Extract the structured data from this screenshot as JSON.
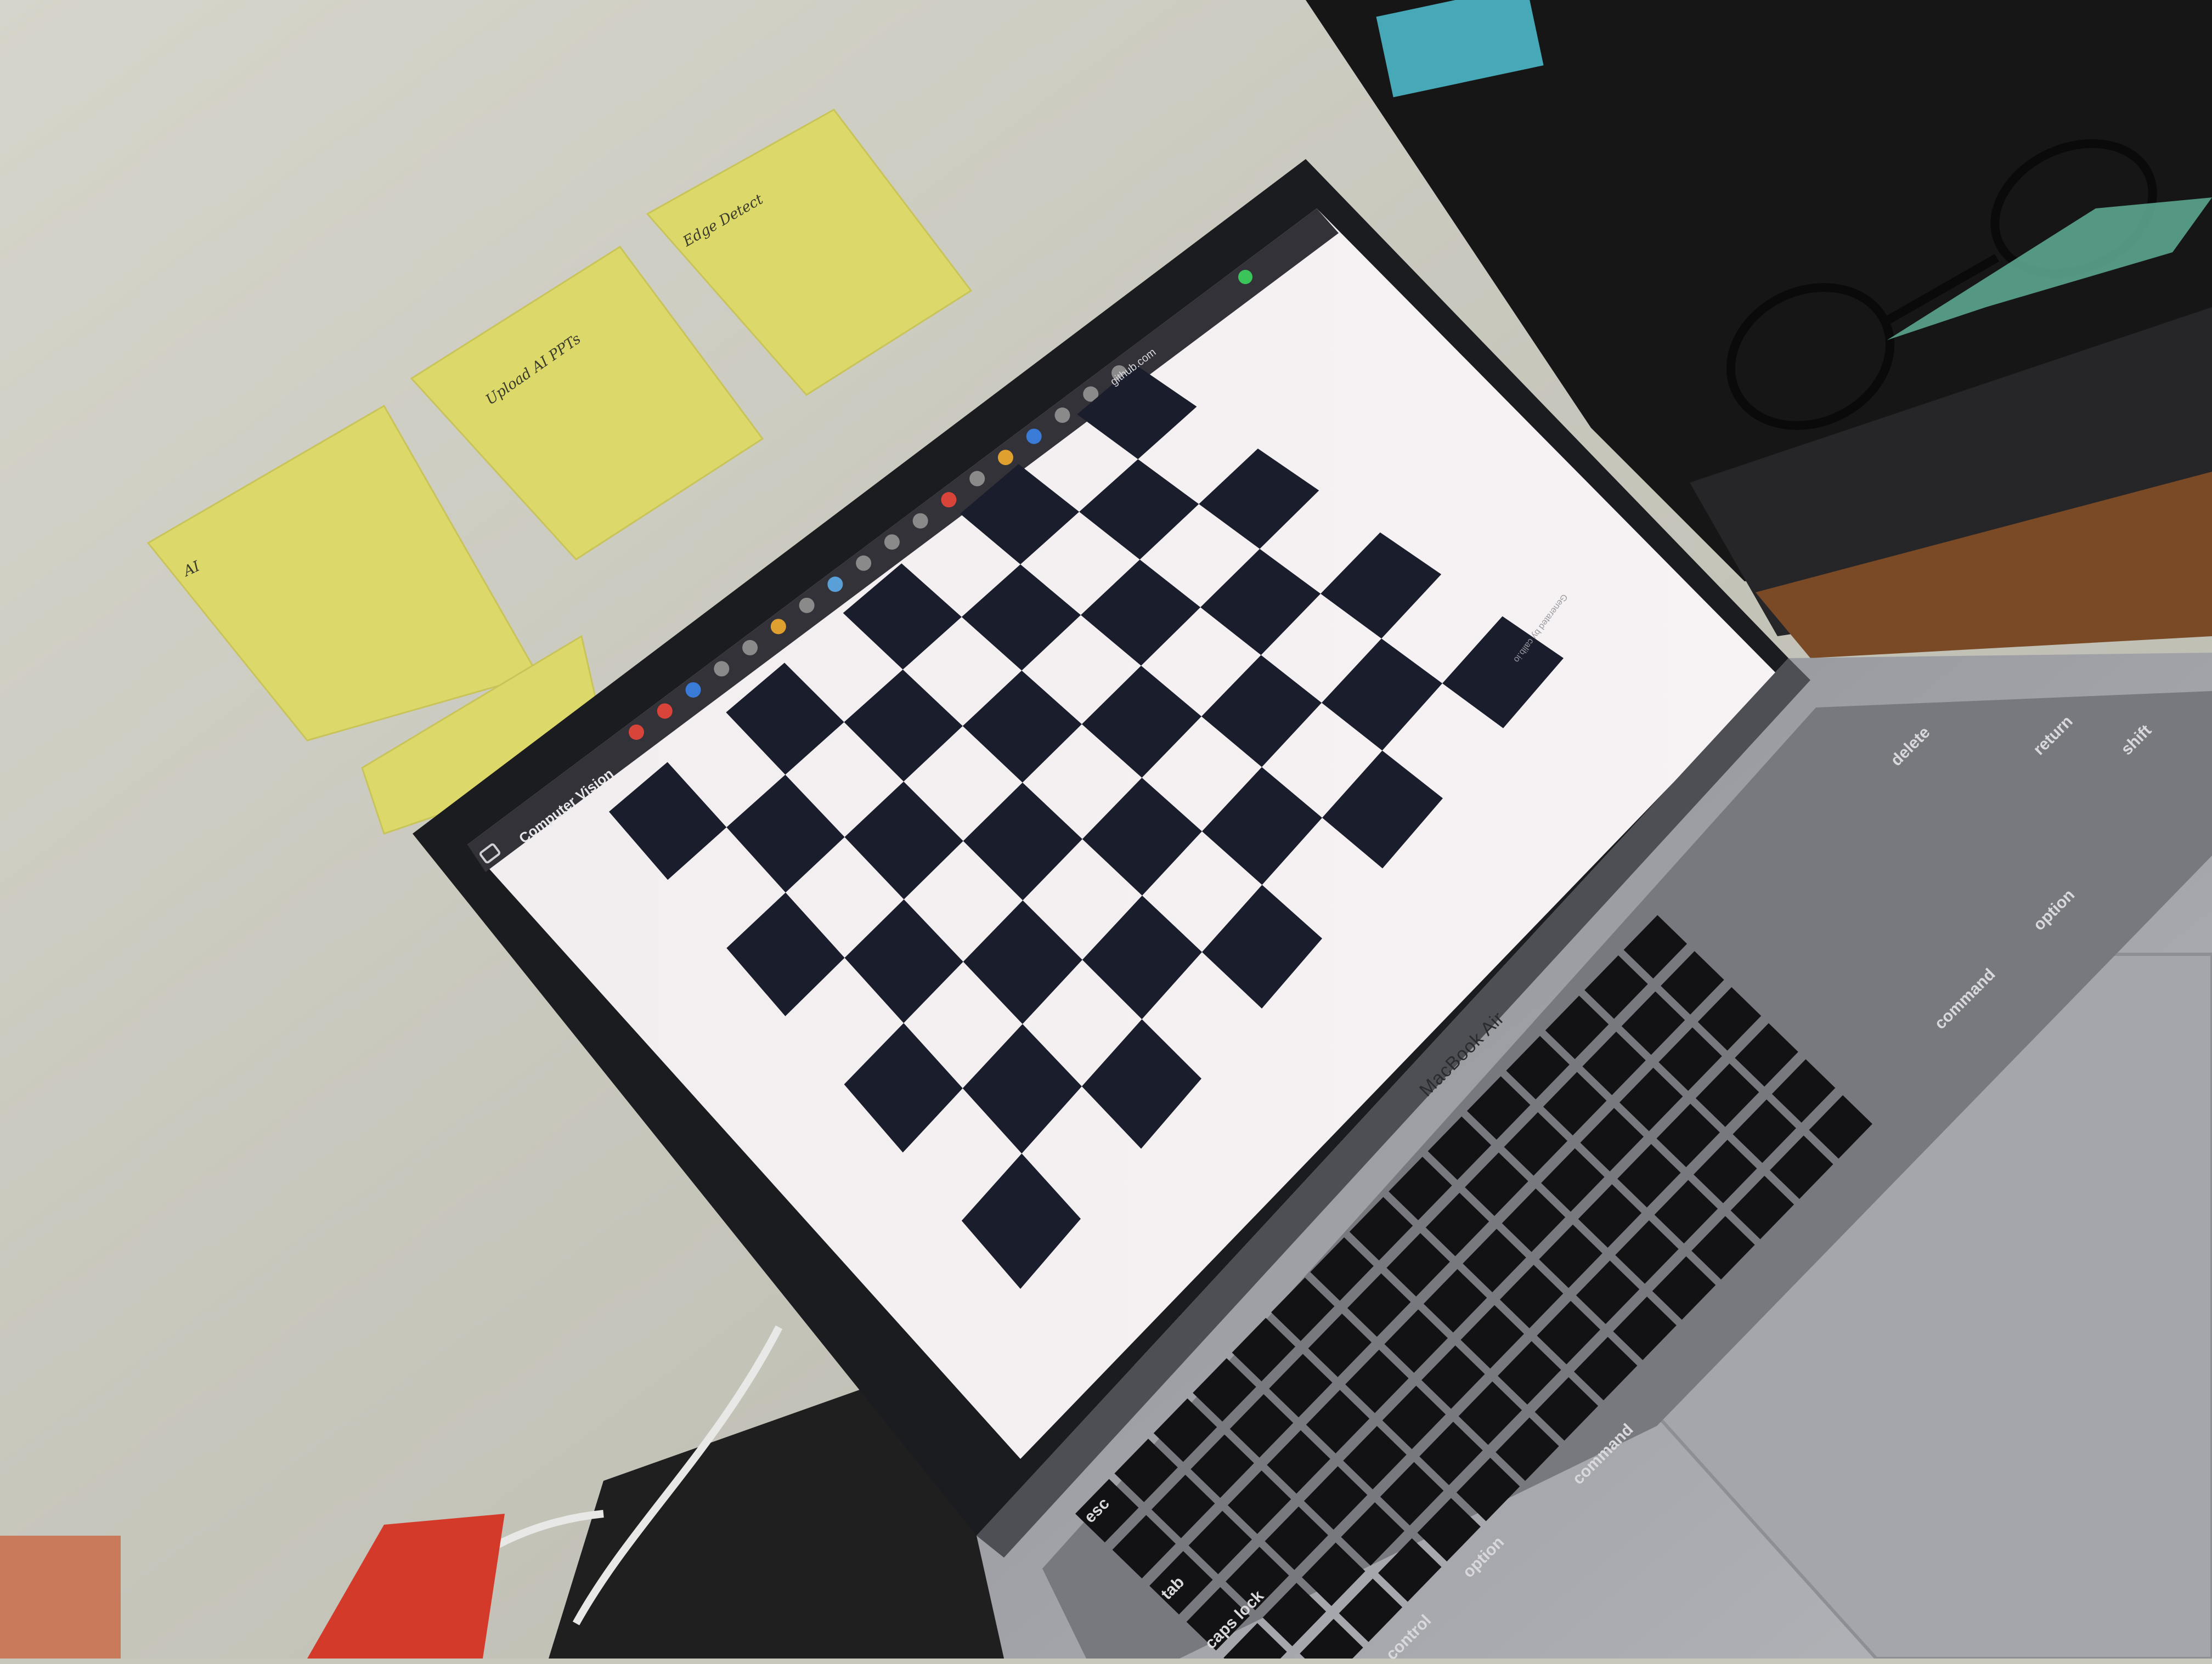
{
  "browser": {
    "tab_title": "Computer Vision",
    "url": "github.com",
    "sidebar_icon": "sidebar-toggle-icon",
    "page_text": "Generated by calib.io"
  },
  "checkerboard": {
    "rows": 7,
    "cols": 9,
    "dark_color": "#1a1d2c",
    "light_color": "#f4eff1"
  },
  "laptop": {
    "brand": "MacBook Air",
    "key_labels": {
      "esc": "esc",
      "tab": "tab",
      "caps": "caps lock",
      "control": "control",
      "option_left": "option",
      "command_left": "command",
      "command_right": "command",
      "option_right": "option",
      "delete": "delete",
      "return": "return",
      "shift": "shift"
    }
  },
  "sticky_notes": [
    {
      "label": "AI"
    },
    {
      "label": "Upload AI PPTs"
    },
    {
      "label": "Edge Detect"
    }
  ],
  "colors": {
    "wall": "#c9c8bd",
    "bezel": "#1b1c20",
    "chassis": "#9fa1a6",
    "sticky": "#dcd96a"
  }
}
